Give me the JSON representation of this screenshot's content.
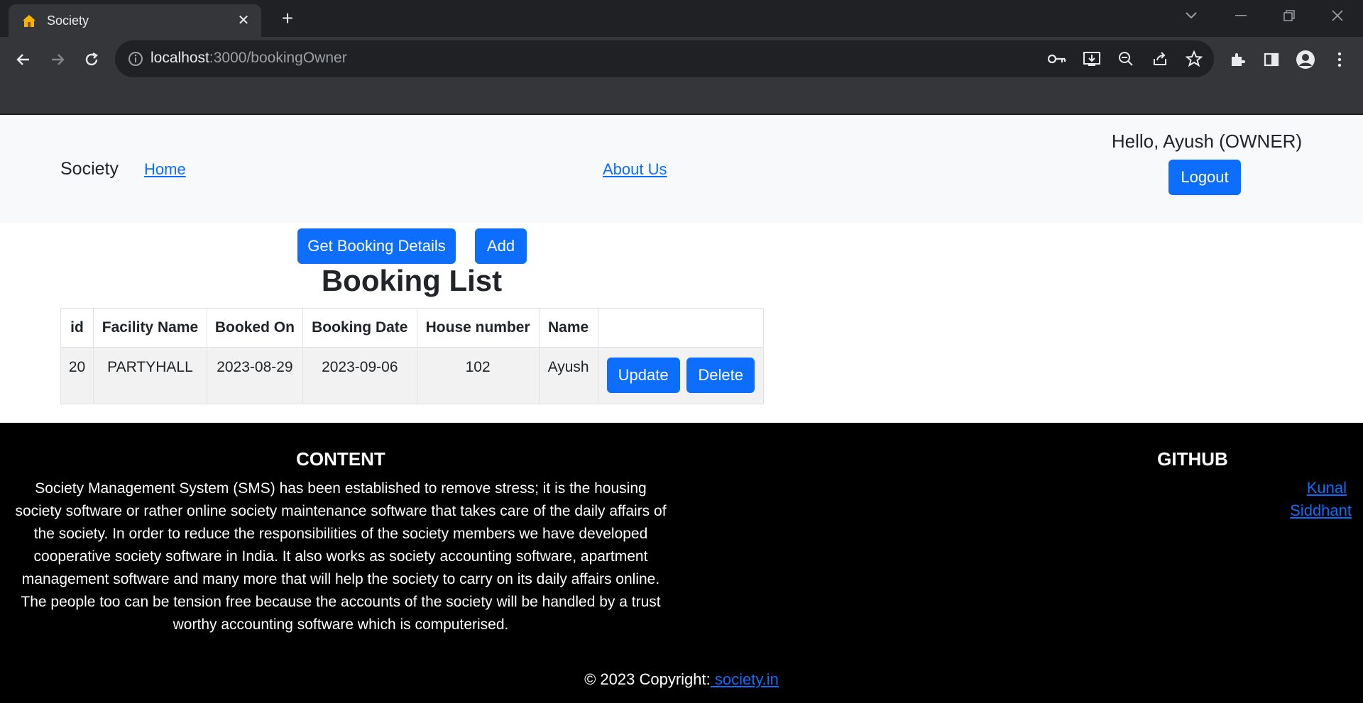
{
  "browser": {
    "tab_title": "Society",
    "url_host": "localhost",
    "url_rest": ":3000/bookingOwner"
  },
  "navbar": {
    "brand": "Society",
    "home_link": "Home",
    "about_link": "About Us",
    "greeting": "Hello, Ayush (OWNER)",
    "logout_label": "Logout"
  },
  "actions": {
    "get_details_label": "Get Booking Details",
    "add_label": "Add"
  },
  "booking": {
    "title": "Booking List",
    "columns": [
      "id",
      "Facility Name",
      "Booked On",
      "Booking Date",
      "House number",
      "Name",
      ""
    ],
    "rows": [
      {
        "id": "20",
        "facility": "PARTYHALL",
        "booked_on": "2023-08-29",
        "booking_date": "2023-09-06",
        "house": "102",
        "name": "Ayush",
        "update_label": "Update",
        "delete_label": "Delete"
      }
    ]
  },
  "footer": {
    "content_heading": "CONTENT",
    "content_text": "Society Management System (SMS) has been established to remove stress; it is the housing society software or rather online society maintenance software that takes care of the daily affairs of the society. In order to reduce the responsibilities of the society members we have developed cooperative society software in India. It also works as society accounting software, apartment management software and many more that will help the society to carry on its daily affairs online. The people too can be tension free because the accounts of the society will be handled by a trust worthy accounting software which is computerised.",
    "github_heading": "GITHUB",
    "github_links": [
      "Kunal",
      "Siddhant"
    ],
    "copyright_prefix": "© 2023 Copyright:",
    "copyright_link": " society.in"
  },
  "colors": {
    "primary": "#0d6efd",
    "navbar_bg": "#f8f9fa",
    "footer_bg": "#000000",
    "chrome_dark": "#202124",
    "chrome_toolbar": "#35363a"
  }
}
